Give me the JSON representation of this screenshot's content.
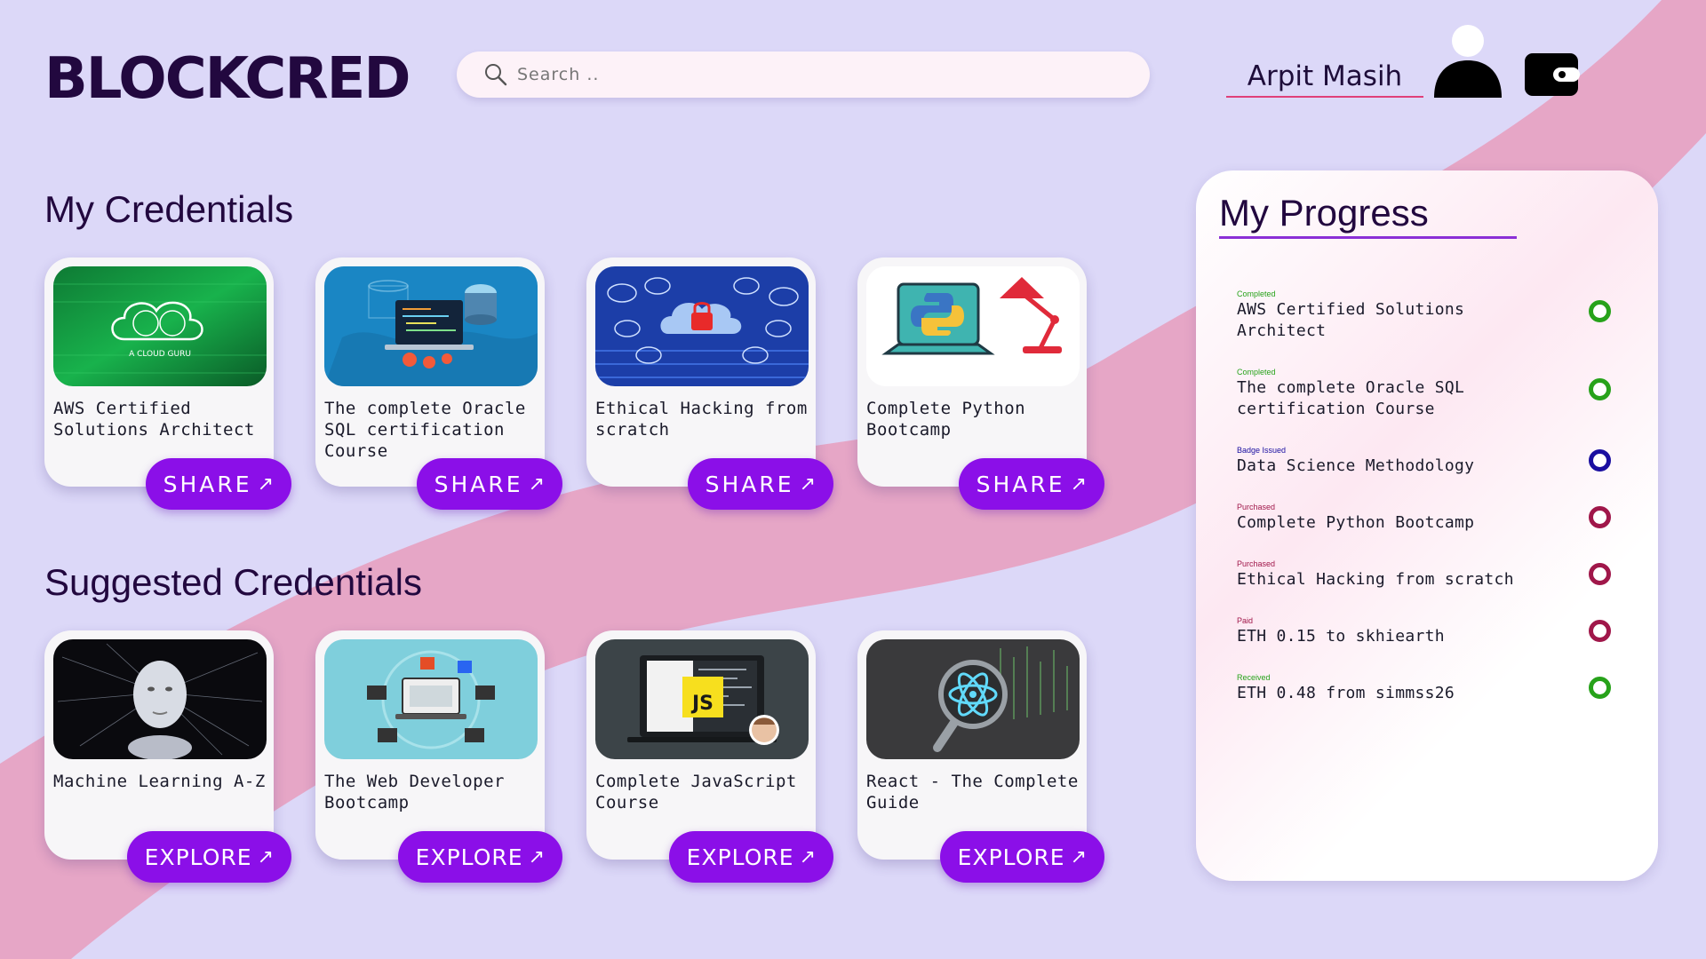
{
  "brand": "BLOCKCRED",
  "search": {
    "placeholder": "Search .."
  },
  "user": {
    "name": "Arpit Masih"
  },
  "icons": {
    "search": "search-icon",
    "avatar": "user-avatar-icon",
    "wallet": "wallet-icon",
    "arrow": "share-arrow-icon"
  },
  "colors": {
    "accent": "#8b0fe8",
    "completed": "#27a21a",
    "badge": "#1a0fa0",
    "purchased": "#a0174a",
    "received": "#27a21a"
  },
  "my_credentials": {
    "title": "My Credentials",
    "action_label": "SHARE",
    "items": [
      {
        "title": "AWS Certified Solutions Architect",
        "thumb_text": "A CLOUD GURU"
      },
      {
        "title": "The complete Oracle SQL certification Course"
      },
      {
        "title": "Ethical Hacking from scratch"
      },
      {
        "title": "Complete Python Bootcamp"
      }
    ]
  },
  "suggested": {
    "title": "Suggested Credentials",
    "action_label": "EXPLORE",
    "items": [
      {
        "title": "Machine Learning A-Z"
      },
      {
        "title": "The Web Developer Bootcamp"
      },
      {
        "title": "Complete JavaScript Course",
        "thumb_text": "JS"
      },
      {
        "title": "React - The Complete Guide"
      }
    ]
  },
  "progress": {
    "title": "My Progress",
    "items": [
      {
        "status": "Completed",
        "label": "AWS Certified Solutions Architect",
        "color": "#27a21a"
      },
      {
        "status": "Completed",
        "label": "The complete Oracle SQL certification Course",
        "color": "#27a21a"
      },
      {
        "status": "Badge Issued",
        "label": "Data Science Methodology",
        "color": "#1a0fa0"
      },
      {
        "status": "Purchased",
        "label": "Complete Python Bootcamp",
        "color": "#a0174a"
      },
      {
        "status": "Purchased",
        "label": "Ethical Hacking from scratch",
        "color": "#a0174a"
      },
      {
        "status": "Paid",
        "label": "ETH 0.15 to skhiearth",
        "color": "#a0174a"
      },
      {
        "status": "Received",
        "label": "ETH 0.48 from simmss26",
        "color": "#27a21a"
      }
    ]
  }
}
